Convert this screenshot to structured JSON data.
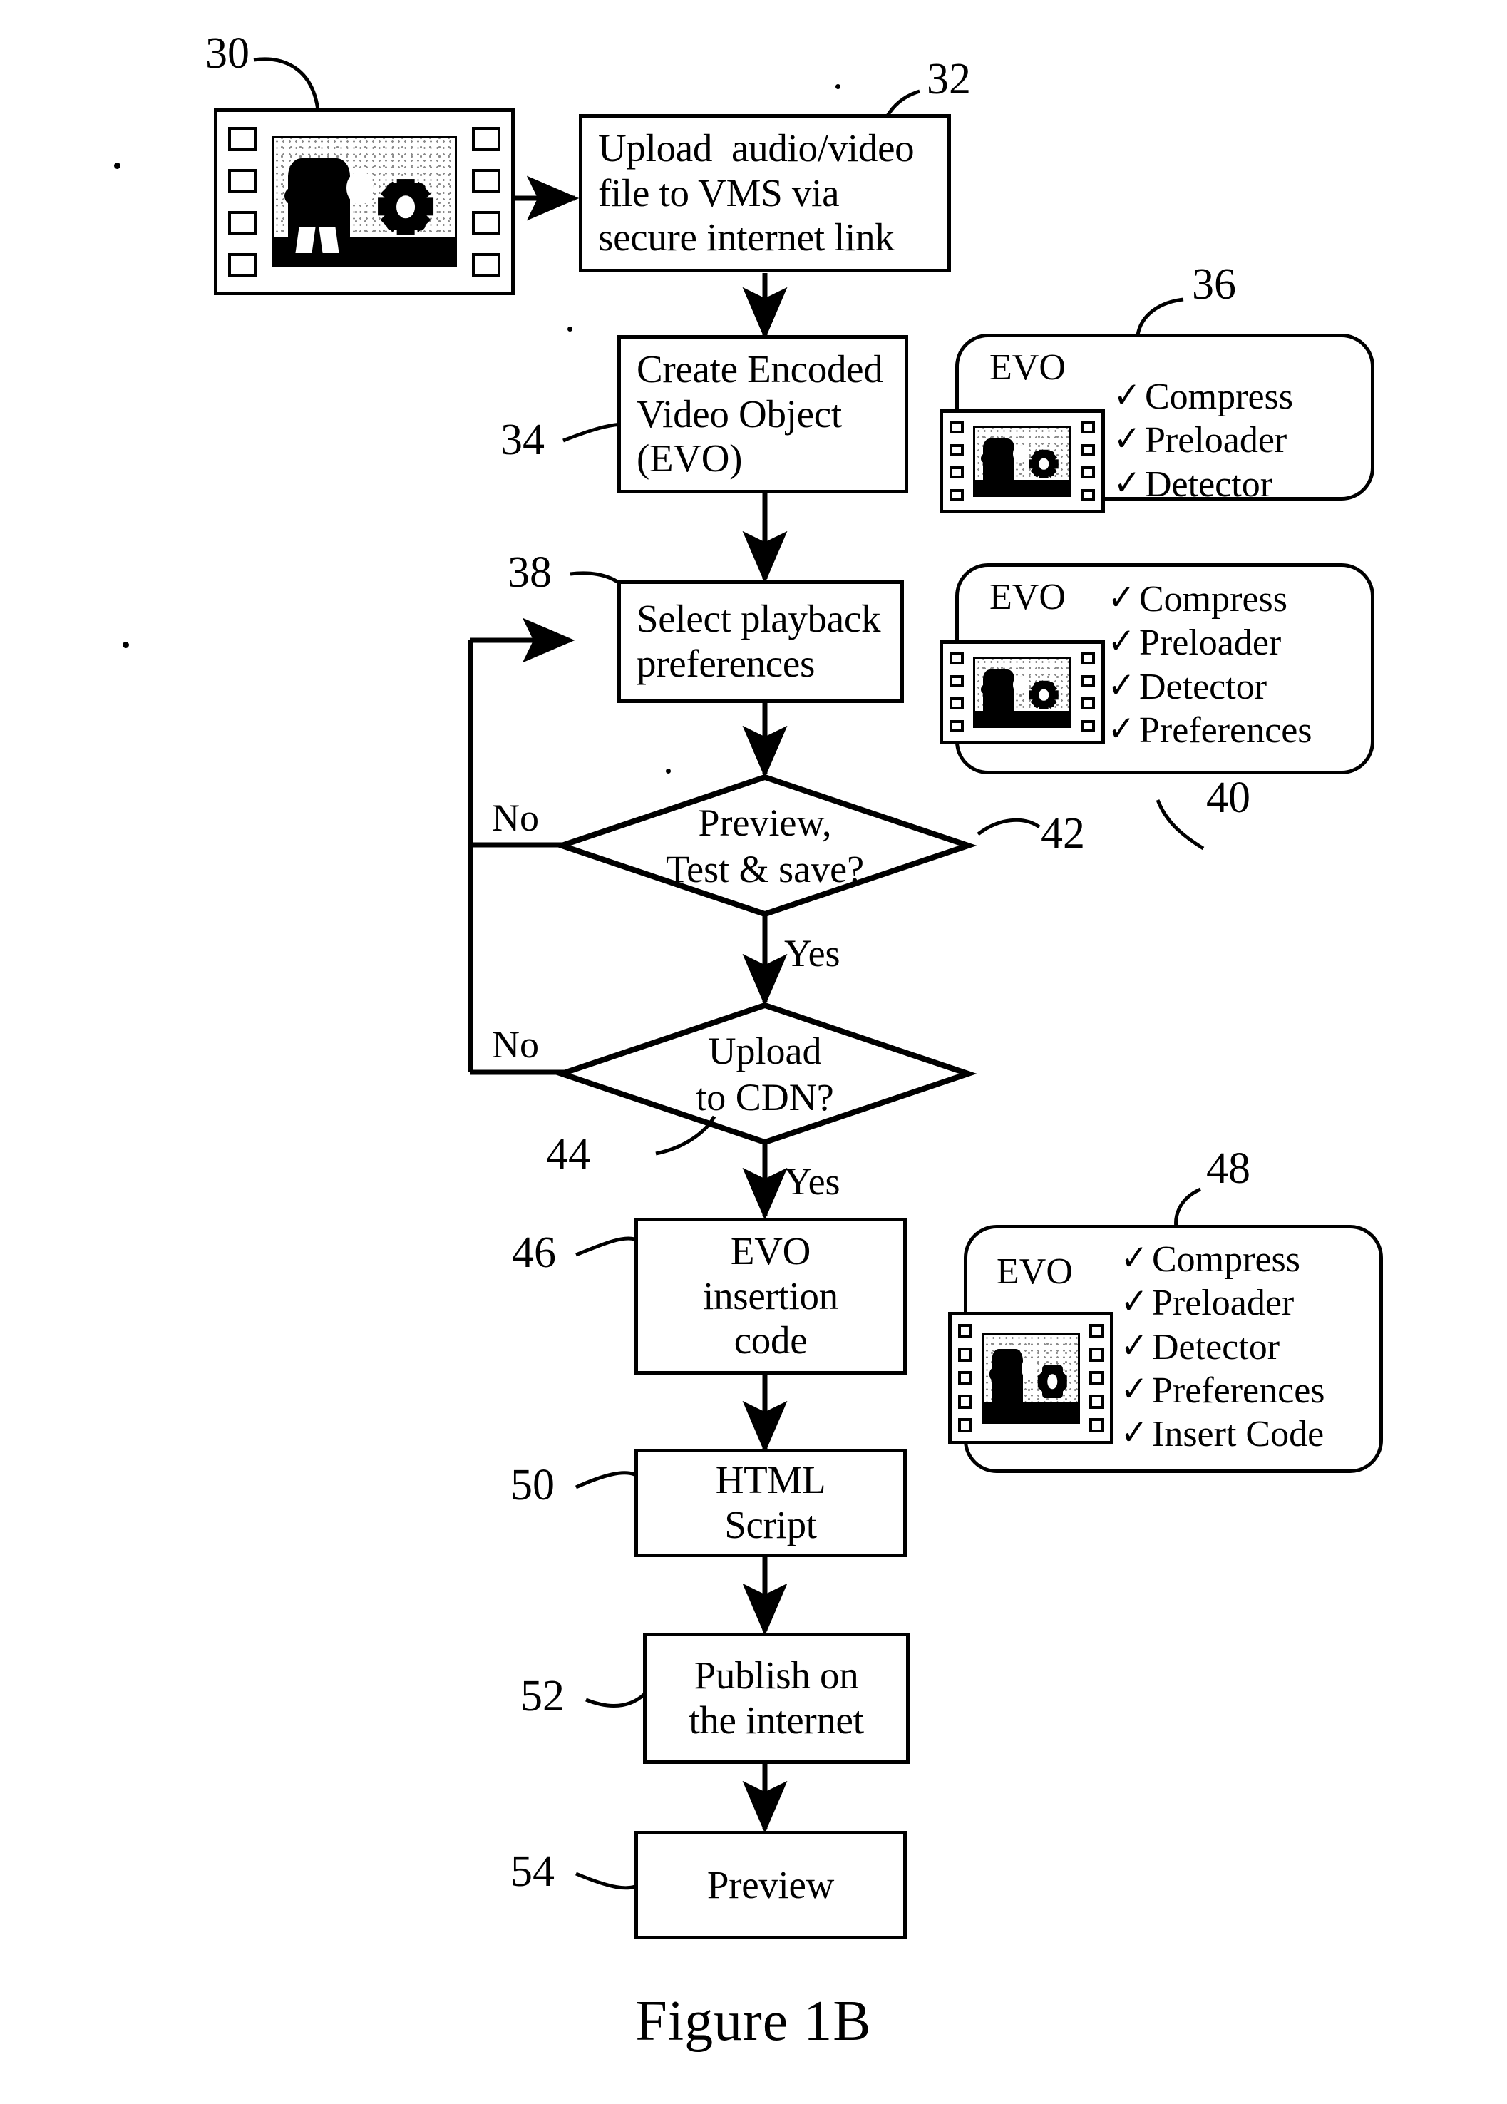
{
  "figure": {
    "caption": "Figure 1B"
  },
  "source_media": {
    "ref": "30",
    "name": "filmstrip"
  },
  "process_boxes": [
    {
      "ref": "32",
      "lines": [
        "Upload  audio/video",
        "file to VMS via",
        "secure internet link"
      ]
    },
    {
      "ref": "34",
      "lines": [
        "Create Encoded",
        "Video Object",
        "(EVO)"
      ]
    },
    {
      "ref": "38",
      "lines": [
        "Select playback",
        "preferences"
      ]
    },
    {
      "ref": "46",
      "lines": [
        "EVO",
        "insertion",
        "code"
      ]
    },
    {
      "ref": "50",
      "lines": [
        "HTML",
        "Script"
      ]
    },
    {
      "ref": "52",
      "lines": [
        "Publish on",
        "the internet"
      ]
    },
    {
      "ref": "54",
      "lines": [
        "Preview"
      ]
    }
  ],
  "decisions": [
    {
      "ref": "42",
      "lines": [
        "Preview,",
        "Test & save?"
      ],
      "no_label": "No",
      "yes_label": "Yes"
    },
    {
      "ref": "44",
      "lines": [
        "Upload",
        "to CDN?"
      ],
      "no_label": "No",
      "yes_label": "Yes"
    }
  ],
  "evo_cards": [
    {
      "ref": "36",
      "title": "EVO",
      "check": "✓",
      "items": [
        "Compress",
        "Preloader",
        "Detector"
      ]
    },
    {
      "ref": "40",
      "title": "EVO",
      "check": "✓",
      "items": [
        "Compress",
        "Preloader",
        "Detector",
        "Preferences"
      ]
    },
    {
      "ref": "48",
      "title": "EVO",
      "check": "✓",
      "items": [
        "Compress",
        "Preloader",
        "Detector",
        "Preferences",
        "Insert Code"
      ]
    }
  ]
}
